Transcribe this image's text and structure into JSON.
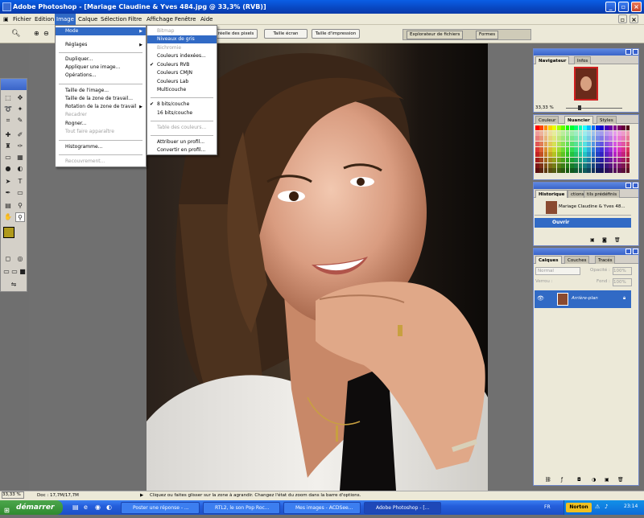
{
  "window": {
    "title": "Adobe Photoshop - [Mariage Claudine & Yves 484.jpg @ 33,3% (RVB)]"
  },
  "menubar": [
    "Fichier",
    "Edition",
    "Image",
    "Calque",
    "Sélection",
    "Filtre",
    "Affichage",
    "Fenêtre",
    "Aide"
  ],
  "options_bar": {
    "zoom_buttons": [
      "Pixels réels",
      "Taille écran",
      "Taille d'impression"
    ],
    "visible_partial_label": "réelle des pixels",
    "palette_well_tabs": [
      "Explorateur de fichiers",
      "Formes"
    ]
  },
  "image_menu": {
    "items": [
      {
        "label": "Mode",
        "state": "highlight",
        "submenu": true
      },
      {
        "label": "Réglages",
        "submenu": true
      },
      {
        "label": "Dupliquer..."
      },
      {
        "label": "Appliquer une image..."
      },
      {
        "label": "Opérations..."
      },
      {
        "label": "Taille de l'image..."
      },
      {
        "label": "Taille de la zone de travail..."
      },
      {
        "label": "Rotation de la zone de travail",
        "submenu": true
      },
      {
        "label": "Recadrer",
        "disabled": true
      },
      {
        "label": "Rogner..."
      },
      {
        "label": "Tout faire apparaître",
        "disabled": true
      },
      {
        "label": "Histogramme..."
      },
      {
        "label": "Recouvrement...",
        "disabled": true
      }
    ]
  },
  "mode_submenu": {
    "items": [
      {
        "label": "Bitmap",
        "disabled": true
      },
      {
        "label": "Niveaux de gris",
        "state": "highlight"
      },
      {
        "label": "Bichromie",
        "disabled": true
      },
      {
        "label": "Couleurs indexées..."
      },
      {
        "label": "Couleurs RVB",
        "checked": true
      },
      {
        "label": "Couleurs CMJN"
      },
      {
        "label": "Couleurs Lab"
      },
      {
        "label": "Multicouche"
      },
      {
        "label": "8 bits/couche",
        "checked": true
      },
      {
        "label": "16 bits/couche"
      },
      {
        "label": "Table des couleurs...",
        "disabled": true
      },
      {
        "label": "Attribuer un profil..."
      },
      {
        "label": "Convertir en profil..."
      }
    ]
  },
  "navigator": {
    "tabs": [
      "Navigateur",
      "Infos"
    ],
    "zoom": "33,33 %"
  },
  "swatches": {
    "tabs": [
      "Couleur",
      "Nuancier",
      "Styles"
    ]
  },
  "history": {
    "tabs": [
      "Historique",
      "Actions",
      "Outils prédéfinis"
    ],
    "visible_tab_fragments": [
      "ctions",
      "tils prédéfinis"
    ],
    "snapshot": "Mariage Claudine & Yves 48...",
    "step": "Ouvrir"
  },
  "layers": {
    "tabs": [
      "Calques",
      "Couches",
      "Tracés"
    ],
    "blend_mode": "Normal",
    "opacity_label": "Opacité :",
    "opacity": "100%",
    "lock_label": "Verrou :",
    "fill_label": "Fond :",
    "fill": "100%",
    "layer_name": "Arrière-plan"
  },
  "status": {
    "zoom": "33,33 %",
    "doc": "Doc : 17,7M/17,7M",
    "hint": "Cliquez ou faites glisser sur la zone à agrandir. Changez l'état du zoom dans la barre d'options."
  },
  "taskbar": {
    "start": "démarrer",
    "tasks": [
      "Poster une réponse - ...",
      "RTL2, le son Pop Roc...",
      "Mes images - ACDSee...",
      "Adobe Photoshop - [..."
    ],
    "lang": "FR",
    "norton": "Norton",
    "clock": "23:14"
  },
  "colors": {
    "xp_blue": "#0a5ee6",
    "menu_highlight": "#316ac5",
    "foreground_swatch": "#b09a1c",
    "background_swatch": "#000000"
  }
}
